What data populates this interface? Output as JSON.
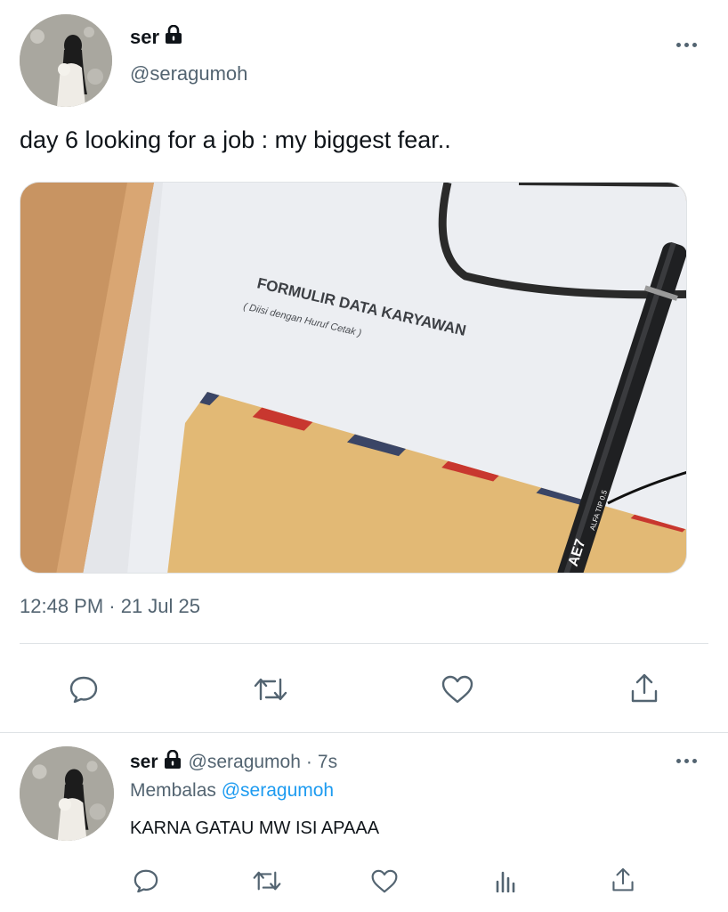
{
  "tweet": {
    "author_name": "ser",
    "author_handle": "@seragumoh",
    "text": "day 6 looking for a job : my biggest fear..",
    "timestamp": "12:48 PM · 21 Jul 25",
    "media": {
      "form_title": "FORMULIR DATA KARYAWAN",
      "form_subtitle": "( Diisi dengan Huruf Cetak )",
      "pen_text": "AE7",
      "pen_subtext": "ALFA TIP 0.5"
    }
  },
  "reply": {
    "author_name": "ser",
    "author_handle": "@seragumoh",
    "separator": "·",
    "time": "7s",
    "replying_prefix": "Membalas",
    "replying_handle": "@seragumoh",
    "text": "KARNA GATAU MW ISI APAAA"
  },
  "icons": [
    "lock-icon",
    "more-icon",
    "reply-icon",
    "retweet-icon",
    "like-icon",
    "share-icon",
    "analytics-icon"
  ],
  "colors": {
    "text": "#0f1419",
    "secondary": "#536471",
    "link": "#1d9bf0",
    "divider": "#dfe3e6"
  }
}
